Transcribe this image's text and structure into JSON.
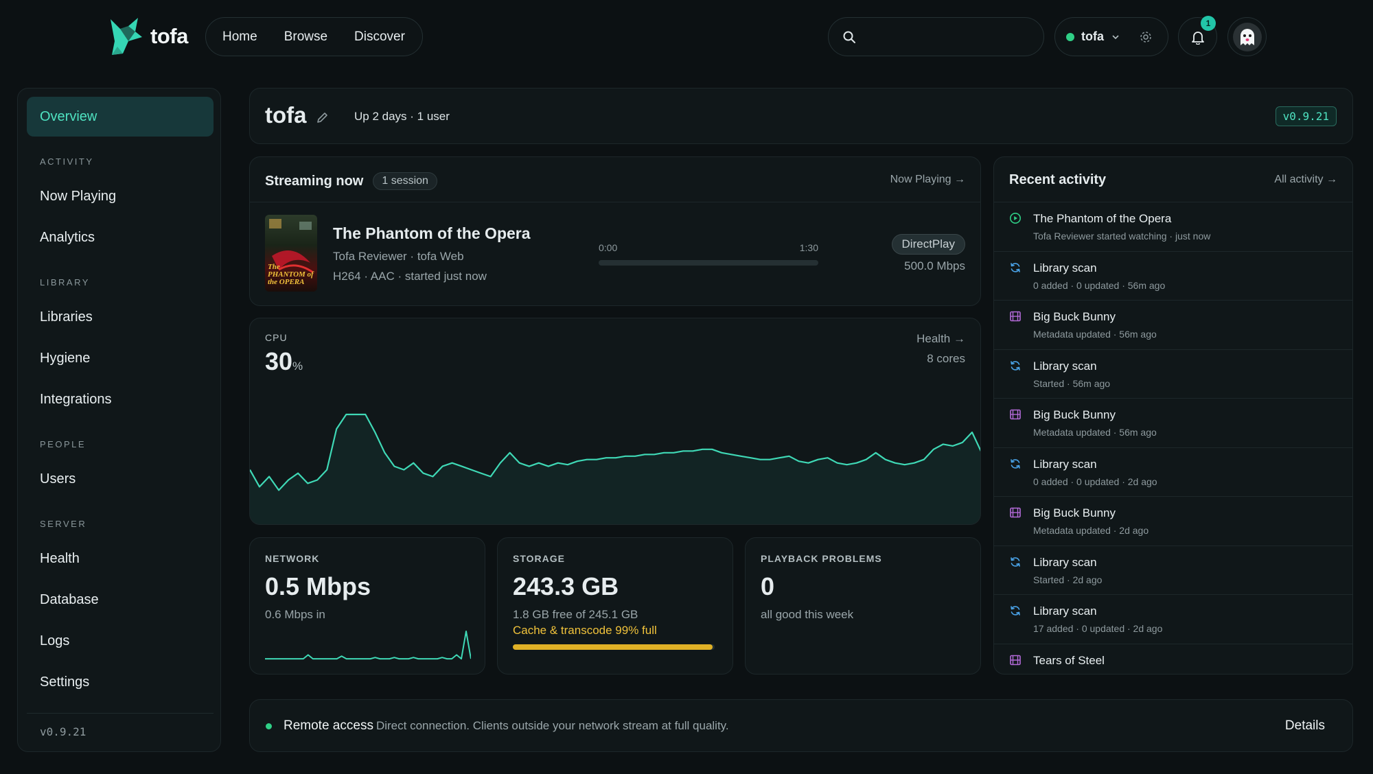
{
  "brand": {
    "name": "tofa"
  },
  "topnav": {
    "items": [
      "Home",
      "Browse",
      "Discover"
    ]
  },
  "search": {
    "placeholder": ""
  },
  "server": {
    "name": "tofa",
    "status_color": "#2fcf86"
  },
  "notifications": {
    "count": "1"
  },
  "sidebar": {
    "active": "Overview",
    "sections": [
      {
        "title": "ACTIVITY",
        "items": [
          "Now Playing",
          "Analytics"
        ]
      },
      {
        "title": "LIBRARY",
        "items": [
          "Libraries",
          "Hygiene",
          "Integrations"
        ]
      },
      {
        "title": "PEOPLE",
        "items": [
          "Users"
        ]
      },
      {
        "title": "SERVER",
        "items": [
          "Health",
          "Database",
          "Logs",
          "Settings"
        ]
      }
    ],
    "version": "v0.9.21"
  },
  "header": {
    "title": "tofa",
    "subtitle": "Up 2 days · 1 user",
    "version": "v0.9.21"
  },
  "streaming": {
    "title": "Streaming now",
    "badge": "1 session",
    "link": "Now Playing →",
    "poster_text": "The PHANTOM of the OPERA",
    "movie_title": "The Phantom of the Opera",
    "user_line": "Tofa Reviewer · tofa Web",
    "codec_line": "H264 · AAC · started just now",
    "time_current": "0:00",
    "time_total": "1:30",
    "progress": 0,
    "play_method": "DirectPlay",
    "bitrate": "500.0 Mbps"
  },
  "cpu": {
    "label": "CPU",
    "value": "30",
    "unit": "%",
    "link": "Health →",
    "cores": "8 cores"
  },
  "stats": {
    "network": {
      "label": "NETWORK",
      "value": "0.5 Mbps",
      "sub": "0.6 Mbps in"
    },
    "storage": {
      "label": "STORAGE",
      "value": "243.3 GB",
      "sub": "1.8 GB free of 245.1 GB",
      "warn": "Cache & transcode 99% full",
      "fill": 0.99
    },
    "problems": {
      "label": "PLAYBACK PROBLEMS",
      "value": "0",
      "sub": "all good this week"
    }
  },
  "activity": {
    "title": "Recent activity",
    "link": "All activity →",
    "items": [
      {
        "icon": "play-circle-icon",
        "name": "The Phantom of the Opera",
        "meta": "Tofa Reviewer started watching · just now"
      },
      {
        "icon": "refresh-icon",
        "name": "Library scan",
        "meta": "0 added · 0 updated · 56m ago"
      },
      {
        "icon": "film-icon",
        "name": "Big Buck Bunny",
        "meta": "Metadata updated · 56m ago"
      },
      {
        "icon": "refresh-icon",
        "name": "Library scan",
        "meta": "Started · 56m ago"
      },
      {
        "icon": "film-icon",
        "name": "Big Buck Bunny",
        "meta": "Metadata updated · 56m ago"
      },
      {
        "icon": "refresh-icon",
        "name": "Library scan",
        "meta": "0 added · 0 updated · 2d ago"
      },
      {
        "icon": "film-icon",
        "name": "Big Buck Bunny",
        "meta": "Metadata updated · 2d ago"
      },
      {
        "icon": "refresh-icon",
        "name": "Library scan",
        "meta": "Started · 2d ago"
      },
      {
        "icon": "refresh-icon",
        "name": "Library scan",
        "meta": "17 added · 0 updated · 2d ago"
      },
      {
        "icon": "film-icon",
        "name": "Tears of Steel",
        "meta": ""
      }
    ]
  },
  "remote": {
    "title": "Remote access",
    "description": "Direct connection. Clients outside your network stream at full quality.",
    "button": "Details"
  },
  "colors": {
    "accent": "#3fd9b6",
    "warning": "#f0c23b",
    "film": "#b36ad8",
    "scan": "#4aa3e8"
  },
  "cpu_series": [
    30,
    20,
    26,
    18,
    24,
    28,
    22,
    24,
    30,
    54,
    74,
    86,
    68,
    52,
    40,
    32,
    30,
    34,
    28,
    26,
    32,
    34,
    32,
    30,
    28,
    26,
    34,
    40,
    34,
    32,
    34,
    32,
    34,
    33,
    35,
    36,
    36,
    37,
    37,
    38,
    38,
    39,
    39,
    40,
    40,
    41,
    41,
    42,
    42,
    40,
    39,
    38,
    37,
    36,
    36,
    37,
    38,
    35,
    34,
    36,
    37,
    34,
    33,
    34,
    36,
    40,
    36,
    34,
    33,
    34,
    36,
    42,
    45,
    44,
    46,
    52,
    40
  ],
  "net_series": [
    1,
    1,
    1,
    1,
    1,
    1,
    1,
    1,
    1,
    4,
    1,
    1,
    1,
    1,
    1,
    1,
    3,
    1,
    1,
    1,
    1,
    1,
    1,
    2,
    1,
    1,
    1,
    2,
    1,
    1,
    1,
    2,
    1,
    1,
    1,
    1,
    1,
    2,
    1,
    1,
    4,
    1,
    22,
    1
  ]
}
